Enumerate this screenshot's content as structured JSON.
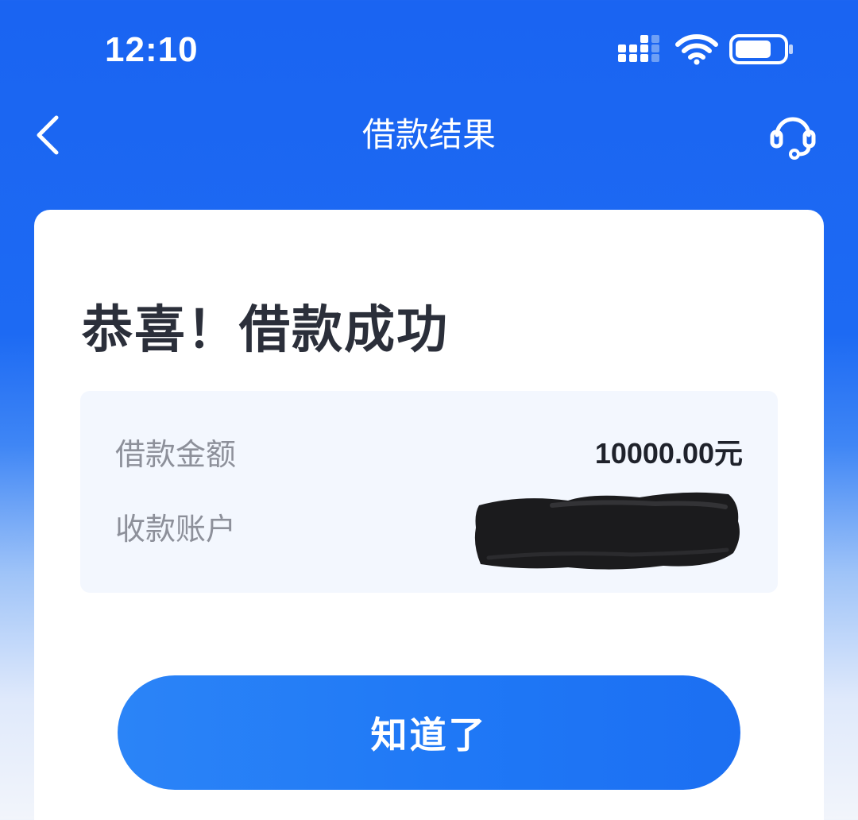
{
  "status_bar": {
    "time": "12:10",
    "icons": [
      "signal-icon",
      "wifi-icon",
      "battery-icon"
    ],
    "battery_level": 0.75
  },
  "nav": {
    "title": "借款结果",
    "back_icon": "chevron-left-icon",
    "support_icon": "headset-icon"
  },
  "result": {
    "heading": "恭喜！借款成功",
    "details": [
      {
        "label": "借款金额",
        "value": "10000.00元"
      },
      {
        "label": "收款账户",
        "value": ""
      }
    ]
  },
  "actions": {
    "confirm_label": "知道了"
  },
  "colors": {
    "primary_blue": "#1a64f2",
    "button_blue": "#1f78f6",
    "card_bg": "#ffffff",
    "detail_bg": "#f3f7fe",
    "heading_text": "#2b2f3a",
    "label_text": "#8d909a",
    "value_text": "#1f222b"
  }
}
